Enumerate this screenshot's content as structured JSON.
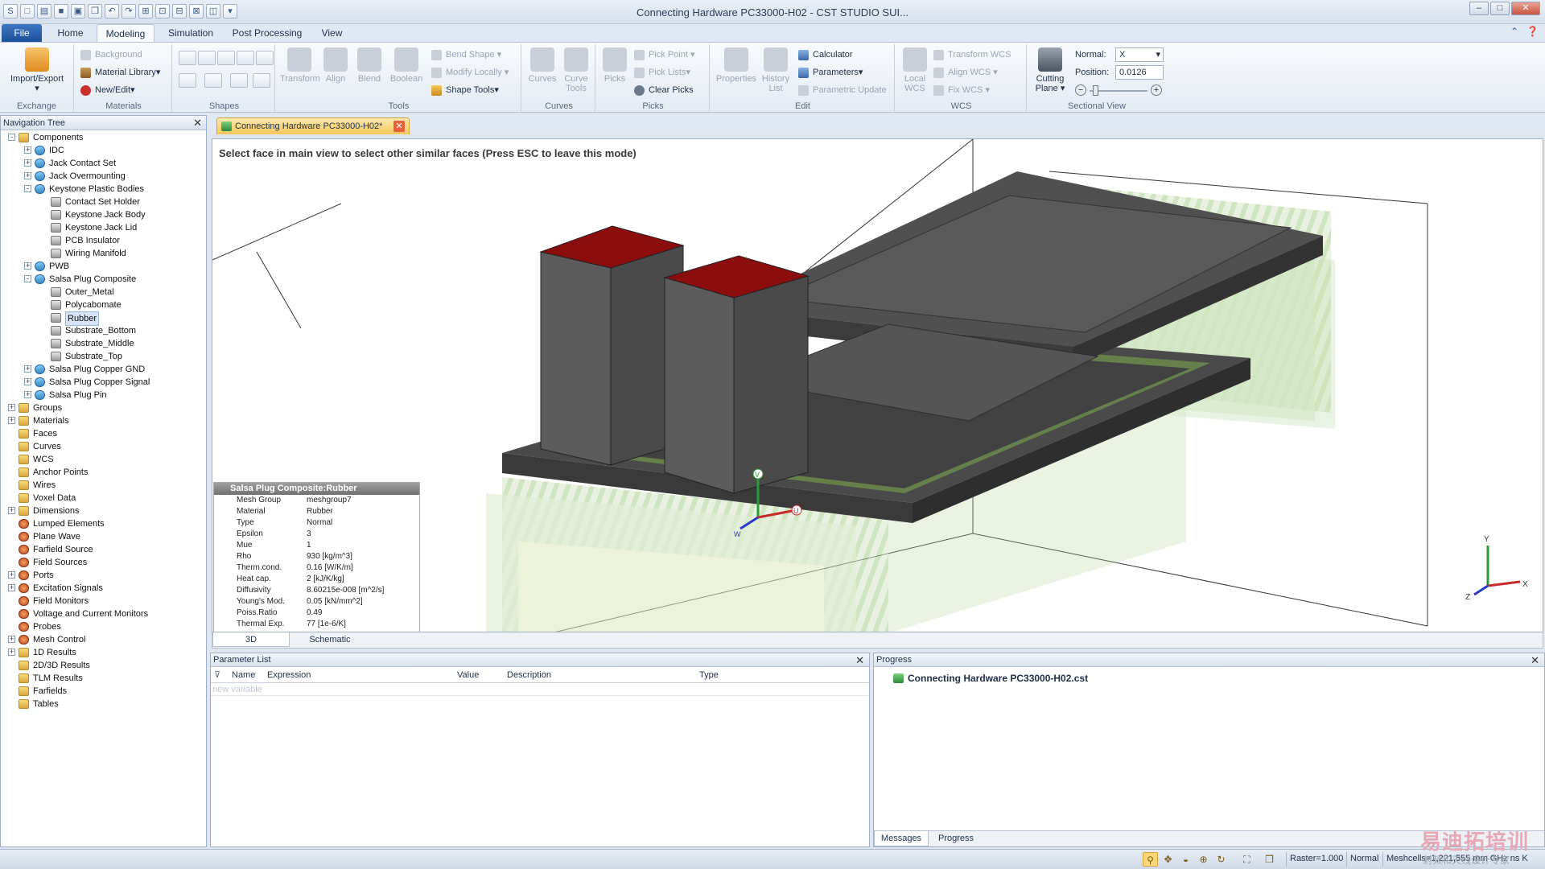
{
  "window": {
    "title": "Connecting Hardware PC33000-H02 - CST STUDIO SUI..."
  },
  "ribbon_tabs": [
    "File",
    "Home",
    "Modeling",
    "Simulation",
    "Post Processing",
    "View"
  ],
  "ribbon": {
    "exchange": {
      "label": "Exchange",
      "import_export": "Import/Export"
    },
    "materials": {
      "label": "Materials",
      "background": "Background",
      "material_library": "Material Library",
      "new_edit": "New/Edit"
    },
    "shapes": {
      "label": "Shapes"
    },
    "tools": {
      "label": "Tools",
      "transform": "Transform",
      "align": "Align",
      "blend": "Blend",
      "boolean": "Boolean",
      "bend_shape": "Bend Shape",
      "modify_locally": "Modify Locally",
      "shape_tools": "Shape Tools"
    },
    "curves": {
      "label": "Curves",
      "curves": "Curves",
      "curve_tools": "Curve Tools"
    },
    "picks": {
      "label": "Picks",
      "picks": "Picks",
      "pick_point": "Pick Point",
      "pick_lists": "Pick Lists",
      "clear_picks": "Clear Picks"
    },
    "edit": {
      "label": "Edit",
      "properties": "Properties",
      "history_list": "History List",
      "calculator": "Calculator",
      "parameters": "Parameters",
      "parametric_update": "Parametric Update"
    },
    "wcs": {
      "label": "WCS",
      "local_wcs": "Local WCS",
      "transform_wcs": "Transform WCS",
      "align_wcs": "Align WCS",
      "fix_wcs": "Fix WCS"
    },
    "sectional": {
      "label": "Sectional View",
      "cutting_plane": "Cutting Plane",
      "normal_label": "Normal:",
      "normal_value": "X",
      "position_label": "Position:",
      "position_value": "0.0126"
    }
  },
  "nav": {
    "title": "Navigation Tree",
    "items": [
      {
        "label": "Components",
        "level": 0,
        "icon": "folder",
        "exp": "-"
      },
      {
        "label": "IDC",
        "level": 1,
        "icon": "comp",
        "exp": "+"
      },
      {
        "label": "Jack Contact Set",
        "level": 1,
        "icon": "comp",
        "exp": "+"
      },
      {
        "label": "Jack Overmounting",
        "level": 1,
        "icon": "comp",
        "exp": "+"
      },
      {
        "label": "Keystone Plastic Bodies",
        "level": 1,
        "icon": "comp",
        "exp": "-"
      },
      {
        "label": "Contact Set Holder",
        "level": 2,
        "icon": "solid",
        "exp": ""
      },
      {
        "label": "Keystone Jack Body",
        "level": 2,
        "icon": "solid",
        "exp": ""
      },
      {
        "label": "Keystone Jack Lid",
        "level": 2,
        "icon": "solid",
        "exp": ""
      },
      {
        "label": "PCB Insulator",
        "level": 2,
        "icon": "solid",
        "exp": ""
      },
      {
        "label": "Wiring Manifold",
        "level": 2,
        "icon": "solid",
        "exp": ""
      },
      {
        "label": "PWB",
        "level": 1,
        "icon": "comp",
        "exp": "+"
      },
      {
        "label": "Salsa Plug Composite",
        "level": 1,
        "icon": "comp",
        "exp": "-"
      },
      {
        "label": "Outer_Metal",
        "level": 2,
        "icon": "solid",
        "exp": ""
      },
      {
        "label": "Polycabomate",
        "level": 2,
        "icon": "solid",
        "exp": ""
      },
      {
        "label": "Rubber",
        "level": 2,
        "icon": "solid",
        "exp": "",
        "selected": true
      },
      {
        "label": "Substrate_Bottom",
        "level": 2,
        "icon": "solid",
        "exp": ""
      },
      {
        "label": "Substrate_Middle",
        "level": 2,
        "icon": "solid",
        "exp": ""
      },
      {
        "label": "Substrate_Top",
        "level": 2,
        "icon": "solid",
        "exp": ""
      },
      {
        "label": "Salsa Plug Copper GND",
        "level": 1,
        "icon": "comp",
        "exp": "+"
      },
      {
        "label": "Salsa Plug Copper Signal",
        "level": 1,
        "icon": "comp",
        "exp": "+"
      },
      {
        "label": "Salsa Plug Pin",
        "level": 1,
        "icon": "comp",
        "exp": "+"
      },
      {
        "label": "Groups",
        "level": 0,
        "icon": "folder",
        "exp": "+"
      },
      {
        "label": "Materials",
        "level": 0,
        "icon": "folder",
        "exp": "+"
      },
      {
        "label": "Faces",
        "level": 0,
        "icon": "folder",
        "exp": ""
      },
      {
        "label": "Curves",
        "level": 0,
        "icon": "folder",
        "exp": ""
      },
      {
        "label": "WCS",
        "level": 0,
        "icon": "folder",
        "exp": ""
      },
      {
        "label": "Anchor Points",
        "level": 0,
        "icon": "folder",
        "exp": ""
      },
      {
        "label": "Wires",
        "level": 0,
        "icon": "folder",
        "exp": ""
      },
      {
        "label": "Voxel Data",
        "level": 0,
        "icon": "folder",
        "exp": ""
      },
      {
        "label": "Dimensions",
        "level": 0,
        "icon": "folder",
        "exp": "+"
      },
      {
        "label": "Lumped Elements",
        "level": 0,
        "icon": "gear",
        "exp": ""
      },
      {
        "label": "Plane Wave",
        "level": 0,
        "icon": "gear",
        "exp": ""
      },
      {
        "label": "Farfield Source",
        "level": 0,
        "icon": "gear",
        "exp": ""
      },
      {
        "label": "Field Sources",
        "level": 0,
        "icon": "gear",
        "exp": ""
      },
      {
        "label": "Ports",
        "level": 0,
        "icon": "gear",
        "exp": "+"
      },
      {
        "label": "Excitation Signals",
        "level": 0,
        "icon": "gear",
        "exp": "+"
      },
      {
        "label": "Field Monitors",
        "level": 0,
        "icon": "gear",
        "exp": ""
      },
      {
        "label": "Voltage and Current Monitors",
        "level": 0,
        "icon": "gear",
        "exp": ""
      },
      {
        "label": "Probes",
        "level": 0,
        "icon": "gear",
        "exp": ""
      },
      {
        "label": "Mesh Control",
        "level": 0,
        "icon": "gear",
        "exp": "+"
      },
      {
        "label": "1D Results",
        "level": 0,
        "icon": "folder",
        "exp": "+"
      },
      {
        "label": "2D/3D Results",
        "level": 0,
        "icon": "folder",
        "exp": ""
      },
      {
        "label": "TLM Results",
        "level": 0,
        "icon": "folder",
        "exp": ""
      },
      {
        "label": "Farfields",
        "level": 0,
        "icon": "folder",
        "exp": ""
      },
      {
        "label": "Tables",
        "level": 0,
        "icon": "folder",
        "exp": ""
      }
    ]
  },
  "document_tab": "Connecting Hardware PC33000-H02*",
  "viewport": {
    "hint": "Select face in main view to select other similar faces (Press ESC to leave this mode)",
    "axis_labels": {
      "v": "V",
      "u": "U",
      "w": "W",
      "x": "X",
      "y": "Y",
      "z": "Z"
    },
    "info": {
      "title": "Salsa Plug Composite:Rubber",
      "rows": [
        {
          "k": "Mesh Group",
          "v": "meshgroup7"
        },
        {
          "k": "Material",
          "v": "Rubber"
        },
        {
          "k": "Type",
          "v": "Normal"
        },
        {
          "k": "Epsilon",
          "v": "3"
        },
        {
          "k": "Mue",
          "v": "1"
        },
        {
          "k": "Rho",
          "v": "930 [kg/m^3]"
        },
        {
          "k": "Therm.cond.",
          "v": "0.16 [W/K/m]"
        },
        {
          "k": "Heat cap.",
          "v": "2 [kJ/K/kg]"
        },
        {
          "k": "Diffusivity",
          "v": "8.60215e-008 [m^2/s]"
        },
        {
          "k": "Young's Mod.",
          "v": "0.05 [kN/mm^2]"
        },
        {
          "k": "Poiss.Ratio",
          "v": "0.49"
        },
        {
          "k": "Thermal Exp.",
          "v": "77 [1e-6/K]"
        }
      ]
    },
    "tabs": [
      "3D",
      "Schematic"
    ]
  },
  "parameter_list": {
    "title": "Parameter List",
    "columns": [
      "Name",
      "Expression",
      "Value",
      "Description",
      "Type"
    ],
    "new_variable": "new variable"
  },
  "progress_panel": {
    "title": "Progress",
    "file": "Connecting Hardware PC33000-H02.cst",
    "tabs": [
      "Messages",
      "Progress"
    ]
  },
  "status": {
    "raster": "Raster=1.000",
    "mode": "Normal",
    "units": "Meshcells=1,221,555  mm  GHz  ns  K"
  },
  "watermark": {
    "main": "易迪拓培训",
    "sub": "射频和天线设计专家"
  }
}
